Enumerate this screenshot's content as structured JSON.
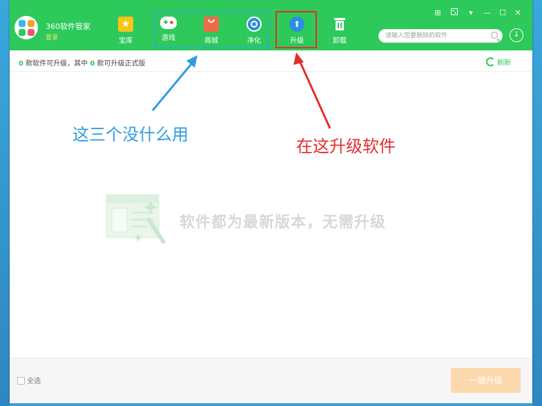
{
  "app": {
    "name": "360软件管家",
    "login_label": "登录"
  },
  "nav": [
    {
      "label": "宝库",
      "icon": "treasure-star-icon"
    },
    {
      "label": "游戏",
      "icon": "gamepad-icon"
    },
    {
      "label": "商城",
      "icon": "shopping-bag-icon"
    },
    {
      "label": "净化",
      "icon": "purify-icon"
    },
    {
      "label": "升级",
      "icon": "upgrade-arrow-icon"
    },
    {
      "label": "卸载",
      "icon": "trash-icon"
    }
  ],
  "search": {
    "placeholder": "请输入您要删除的软件"
  },
  "window_controls": {
    "skin": "⊞",
    "menu": "▾",
    "minimize": "—",
    "maximize": "☐",
    "close": "✕"
  },
  "status": {
    "upgradable_count": "0",
    "text1": "款软件可升级，其中",
    "official_count": "0",
    "text2": "款可升级正式版"
  },
  "refresh_label": "刷新",
  "annotations": {
    "blue": "这三个没什么用",
    "red": "在这升级软件"
  },
  "empty_message": "软件都为最新版本，无需升级",
  "footer": {
    "select_all": "全选",
    "one_key_upgrade": "一键升级"
  },
  "colors": {
    "brand_green": "#2dc95a",
    "annotation_blue": "#2f9de0",
    "annotation_red": "#e12f2f",
    "button_peach": "#fcd9ad"
  }
}
